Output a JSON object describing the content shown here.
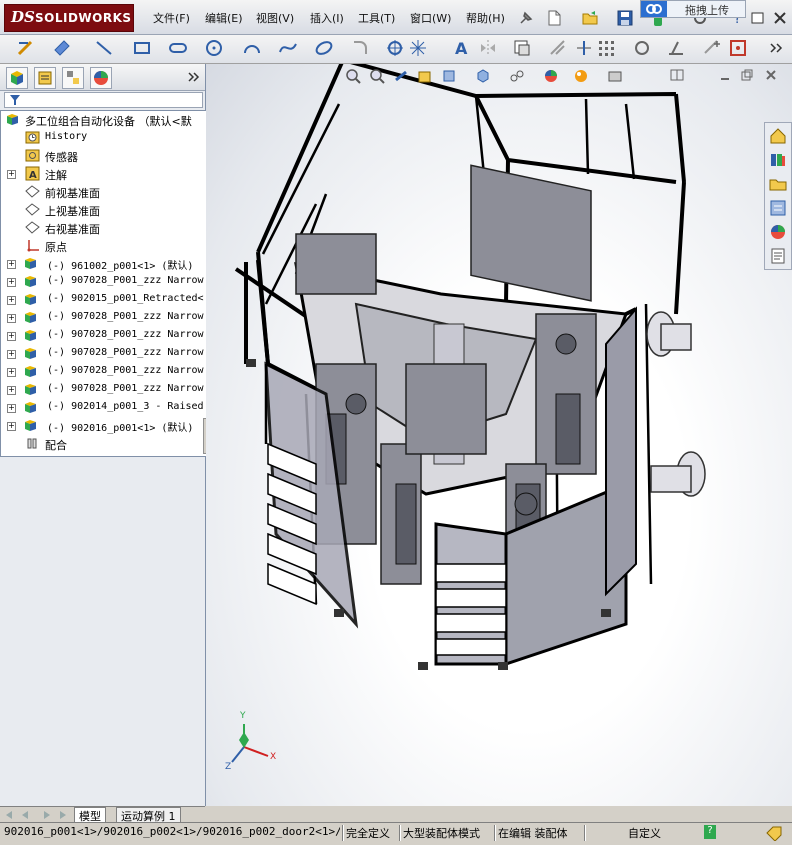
{
  "app": {
    "brand_ds": "DS",
    "brand_name": "SOLIDWORKS"
  },
  "menu": [
    "文件(F)",
    "编辑(E)",
    "视图(V)",
    "插入(I)",
    "工具(T)",
    "窗口(W)",
    "帮助(H)"
  ],
  "overlay_button": "拖拽上传",
  "tree": {
    "filter_icon": "filter-icon",
    "root": "多工位组合自动化设备 （默认<默",
    "items": [
      {
        "label": "History",
        "icon": "history-icon",
        "mono": true
      },
      {
        "label": "传感器",
        "icon": "sensor-icon"
      },
      {
        "label": "注解",
        "icon": "annotation-icon"
      },
      {
        "label": "前视基准面",
        "icon": "plane-icon"
      },
      {
        "label": "上视基准面",
        "icon": "plane-icon"
      },
      {
        "label": "右视基准面",
        "icon": "plane-icon"
      },
      {
        "label": "原点",
        "icon": "origin-icon"
      },
      {
        "label": "(-) 961002_p001<1> (默认)",
        "icon": "assembly-icon"
      },
      {
        "label": "(-) 907028_P001_zzz Narrow",
        "icon": "assembly-icon"
      },
      {
        "label": "(-) 902015_p001_Retracted<",
        "icon": "assembly-icon"
      },
      {
        "label": "(-) 907028_P001_zzz Narrow",
        "icon": "assembly-icon"
      },
      {
        "label": "(-) 907028_P001_zzz Narrow",
        "icon": "assembly-icon"
      },
      {
        "label": "(-) 907028_P001_zzz Narrow",
        "icon": "assembly-icon"
      },
      {
        "label": "(-) 907028_P001_zzz Narrow",
        "icon": "assembly-icon"
      },
      {
        "label": "(-) 907028_P001_zzz Narrow",
        "icon": "assembly-icon"
      },
      {
        "label": "(-) 902014_p001_3 - Raised",
        "icon": "assembly-icon"
      },
      {
        "label": "(-) 902016_p001<1> (默认)",
        "icon": "assembly-icon"
      },
      {
        "label": "配合",
        "icon": "mates-icon"
      }
    ]
  },
  "bottom_tabs": [
    "模型",
    "运动算例 1"
  ],
  "triad": {
    "x": "X",
    "y": "Y",
    "z": "Z"
  },
  "status": {
    "path": "902016_p001<1>/902016_p002<1>/902016_p002_door2<1>/...",
    "defined": "完全定义",
    "mode": "大型装配体模式",
    "editing": "在编辑 装配体",
    "units": "自定义",
    "help": "?"
  }
}
